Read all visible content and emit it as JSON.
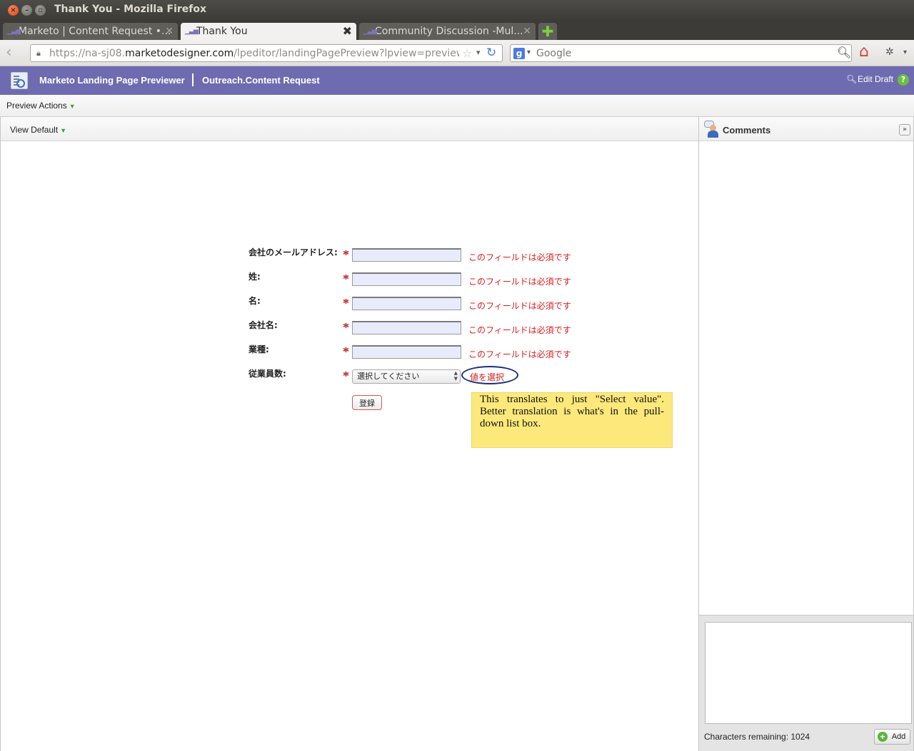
{
  "window": {
    "title": "Thank You - Mozilla Firefox"
  },
  "tabs": [
    {
      "label": "Marketo | Content Request •...",
      "active": false
    },
    {
      "label": "Thank You",
      "active": true
    },
    {
      "label": "Community Discussion -Mul...",
      "active": false
    }
  ],
  "navbar": {
    "url_prefix": "https://na-sj08.",
    "url_host": "marketodesigner.com",
    "url_path": "/lpeditor/landingPagePreview?lpview=preview&",
    "search_placeholder": "Google"
  },
  "header": {
    "app_title": "Marketo Landing Page Previewer",
    "page_name": "Outreach.Content Request",
    "edit_draft": "Edit Draft",
    "help": "?"
  },
  "toolbar": {
    "preview_actions": "Preview Actions",
    "view_default": "View Default"
  },
  "form": {
    "required_mark": "*",
    "fields": [
      {
        "label": "会社のメールアドレス:",
        "value": "",
        "error": "このフィールドは必須です"
      },
      {
        "label": "姓:",
        "value": "",
        "error": "このフィールドは必須です"
      },
      {
        "label": "名:",
        "value": "",
        "error": "このフィールドは必須です"
      },
      {
        "label": "会社名:",
        "value": "",
        "error": "このフィールドは必須です"
      },
      {
        "label": "業種:",
        "value": "",
        "error": "このフィールドは必須です"
      }
    ],
    "select_field": {
      "label": "従業員数:",
      "selected": "選択してください",
      "error": "値を選択"
    },
    "submit_label": "登録"
  },
  "annotation": {
    "note": "This translates to just \"Select value\". Better translation is what's in the pull-down list box."
  },
  "comments": {
    "title": "Comments",
    "chars_remaining": "Characters remaining: 1024",
    "add_label": "Add"
  },
  "colors": {
    "header_bg": "#6f6bb0",
    "error_text": "#d81d1d",
    "note_bg": "#fde97b",
    "input_bg": "#e8ebfb"
  }
}
